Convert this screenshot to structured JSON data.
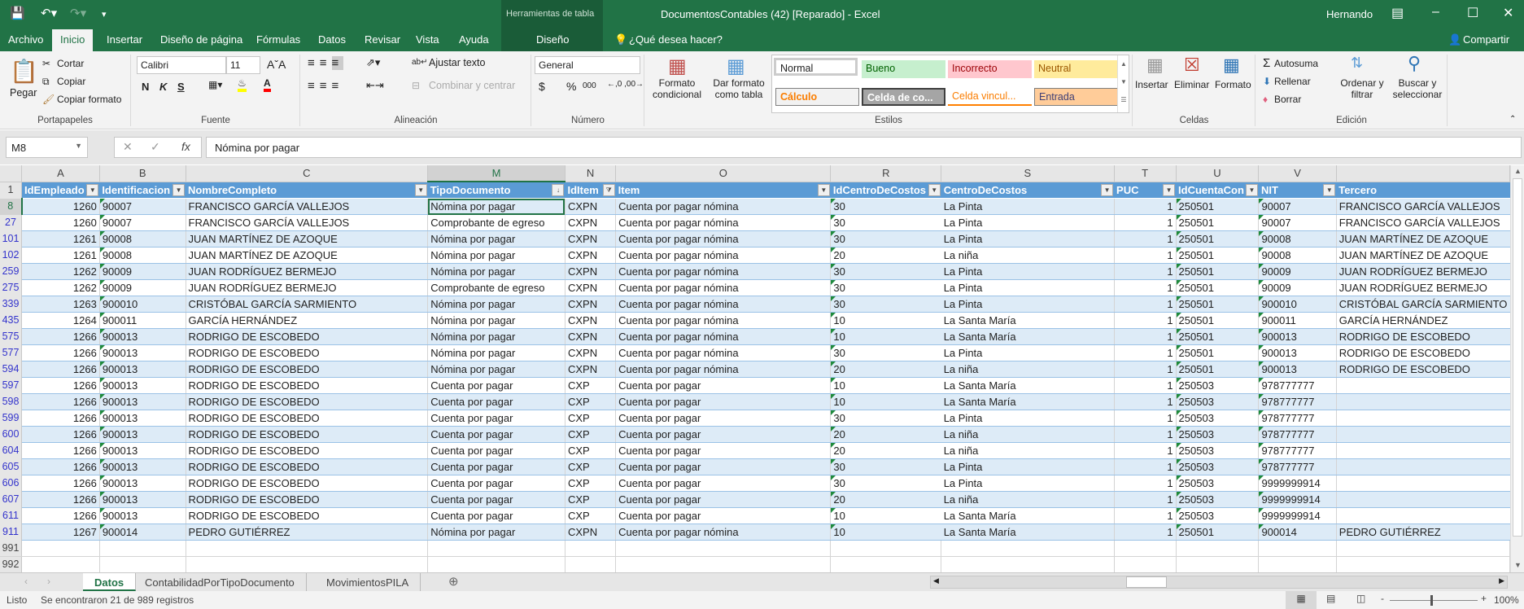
{
  "window": {
    "title": "DocumentosContables (42) [Reparado]  -  Excel",
    "contextual_group": "Herramientas de tabla",
    "user": "Hernando",
    "share": "Compartir"
  },
  "ribbon_tabs": [
    "Archivo",
    "Inicio",
    "Insertar",
    "Diseño de página",
    "Fórmulas",
    "Datos",
    "Revisar",
    "Vista",
    "Ayuda",
    "Diseño"
  ],
  "active_tab": "Inicio",
  "tell_me": "¿Qué desea hacer?",
  "ribbon": {
    "clipboard": {
      "label": "Portapapeles",
      "paste": "Pegar",
      "cut": "Cortar",
      "copy": "Copiar",
      "format_painter": "Copiar formato"
    },
    "font": {
      "label": "Fuente",
      "name": "Calibri",
      "size": "11",
      "bold": "N",
      "italic": "K",
      "underline": "S",
      "fill_color": "#ffff00",
      "font_color": "#ff0000"
    },
    "alignment": {
      "label": "Alineación",
      "wrap": "Ajustar texto",
      "merge": "Combinar y centrar"
    },
    "number": {
      "label": "Número",
      "format": "General",
      "currency": "$",
      "percent": "%",
      "thousands": "000"
    },
    "styles": {
      "label": "Estilos",
      "conditional": "Formato condicional",
      "as_table": "Dar formato como tabla",
      "cells": [
        {
          "label": "Normal",
          "bg": "#ffffff",
          "fg": "#000000"
        },
        {
          "label": "Bueno",
          "bg": "#c6efce",
          "fg": "#006100"
        },
        {
          "label": "Incorrecto",
          "bg": "#ffc7ce",
          "fg": "#9c0006"
        },
        {
          "label": "Neutral",
          "bg": "#ffeb9c",
          "fg": "#9c5700"
        },
        {
          "label": "Cálculo",
          "bg": "#f2f2f2",
          "fg": "#fa7d00"
        },
        {
          "label": "Celda de co...",
          "bg": "#a5a5a5",
          "fg": "#ffffff"
        },
        {
          "label": "Celda vincul...",
          "bg": "#ffffff",
          "fg": "#fa7d00"
        },
        {
          "label": "Entrada",
          "bg": "#ffcc99",
          "fg": "#3f3f76"
        }
      ]
    },
    "cells": {
      "label": "Celdas",
      "insert": "Insertar",
      "delete": "Eliminar",
      "format": "Formato"
    },
    "editing": {
      "label": "Edición",
      "autosum": "Autosuma",
      "fill": "Rellenar",
      "clear": "Borrar",
      "sort": "Ordenar y filtrar",
      "find": "Buscar y seleccionar"
    }
  },
  "formula_bar": {
    "name_box": "M8",
    "fx": "fx",
    "value": "Nómina por pagar"
  },
  "columns": [
    "A",
    "B",
    "C",
    "M",
    "N",
    "O",
    "R",
    "S",
    "T",
    "U",
    "V",
    ""
  ],
  "selected_column": "M",
  "headers": [
    "IdEmpleado",
    "Identificacion",
    "NombreCompleto",
    "TipoDocumento",
    "IdItem",
    "Item",
    "IdCentroDeCostos",
    "CentroDeCostos",
    "PUC",
    "IdCuentaCon",
    "NIT",
    "Tercero"
  ],
  "rows": [
    {
      "n": "8",
      "cells": [
        "1260",
        "90007",
        "FRANCISCO GARCÍA VALLEJOS",
        "Nómina por pagar",
        "CXPN",
        "Cuenta por pagar nómina",
        "30",
        "La Pinta",
        "1",
        "250501",
        "90007",
        "FRANCISCO GARCÍA VALLEJOS"
      ]
    },
    {
      "n": "27",
      "cells": [
        "1260",
        "90007",
        "FRANCISCO GARCÍA VALLEJOS",
        "Comprobante de egreso",
        "CXPN",
        "Cuenta por pagar nómina",
        "30",
        "La Pinta",
        "1",
        "250501",
        "90007",
        "FRANCISCO GARCÍA VALLEJOS"
      ]
    },
    {
      "n": "101",
      "cells": [
        "1261",
        "90008",
        "JUAN MARTÍNEZ DE AZOQUE",
        "Nómina por pagar",
        "CXPN",
        "Cuenta por pagar nómina",
        "30",
        "La Pinta",
        "1",
        "250501",
        "90008",
        "JUAN MARTÍNEZ DE AZOQUE"
      ]
    },
    {
      "n": "102",
      "cells": [
        "1261",
        "90008",
        "JUAN MARTÍNEZ DE AZOQUE",
        "Nómina por pagar",
        "CXPN",
        "Cuenta por pagar nómina",
        "20",
        "La niña",
        "1",
        "250501",
        "90008",
        "JUAN MARTÍNEZ DE AZOQUE"
      ]
    },
    {
      "n": "259",
      "cells": [
        "1262",
        "90009",
        "JUAN RODRÍGUEZ BERMEJO",
        "Nómina por pagar",
        "CXPN",
        "Cuenta por pagar nómina",
        "30",
        "La Pinta",
        "1",
        "250501",
        "90009",
        "JUAN RODRÍGUEZ BERMEJO"
      ]
    },
    {
      "n": "275",
      "cells": [
        "1262",
        "90009",
        "JUAN RODRÍGUEZ BERMEJO",
        "Comprobante de egreso",
        "CXPN",
        "Cuenta por pagar nómina",
        "30",
        "La Pinta",
        "1",
        "250501",
        "90009",
        "JUAN RODRÍGUEZ BERMEJO"
      ]
    },
    {
      "n": "339",
      "cells": [
        "1263",
        "900010",
        "CRISTÓBAL GARCÍA SARMIENTO",
        "Nómina por pagar",
        "CXPN",
        "Cuenta por pagar nómina",
        "30",
        "La Pinta",
        "1",
        "250501",
        "900010",
        "CRISTÓBAL GARCÍA SARMIENTO"
      ]
    },
    {
      "n": "435",
      "cells": [
        "1264",
        "900011",
        "GARCÍA HERNÁNDEZ",
        "Nómina por pagar",
        "CXPN",
        "Cuenta por pagar nómina",
        "10",
        "La Santa María",
        "1",
        "250501",
        "900011",
        "GARCÍA HERNÁNDEZ"
      ]
    },
    {
      "n": "575",
      "cells": [
        "1266",
        "900013",
        "RODRIGO DE ESCOBEDO",
        "Nómina por pagar",
        "CXPN",
        "Cuenta por pagar nómina",
        "10",
        "La Santa María",
        "1",
        "250501",
        "900013",
        "RODRIGO DE ESCOBEDO"
      ]
    },
    {
      "n": "577",
      "cells": [
        "1266",
        "900013",
        "RODRIGO DE ESCOBEDO",
        "Nómina por pagar",
        "CXPN",
        "Cuenta por pagar nómina",
        "30",
        "La Pinta",
        "1",
        "250501",
        "900013",
        "RODRIGO DE ESCOBEDO"
      ]
    },
    {
      "n": "594",
      "cells": [
        "1266",
        "900013",
        "RODRIGO DE ESCOBEDO",
        "Nómina por pagar",
        "CXPN",
        "Cuenta por pagar nómina",
        "20",
        "La niña",
        "1",
        "250501",
        "900013",
        "RODRIGO DE ESCOBEDO"
      ]
    },
    {
      "n": "597",
      "cells": [
        "1266",
        "900013",
        "RODRIGO DE ESCOBEDO",
        "Cuenta por pagar",
        "CXP",
        "Cuenta por pagar",
        "10",
        "La Santa María",
        "1",
        "250503",
        "978777777",
        ""
      ]
    },
    {
      "n": "598",
      "cells": [
        "1266",
        "900013",
        "RODRIGO DE ESCOBEDO",
        "Cuenta por pagar",
        "CXP",
        "Cuenta por pagar",
        "10",
        "La Santa María",
        "1",
        "250503",
        "978777777",
        ""
      ]
    },
    {
      "n": "599",
      "cells": [
        "1266",
        "900013",
        "RODRIGO DE ESCOBEDO",
        "Cuenta por pagar",
        "CXP",
        "Cuenta por pagar",
        "30",
        "La Pinta",
        "1",
        "250503",
        "978777777",
        ""
      ]
    },
    {
      "n": "600",
      "cells": [
        "1266",
        "900013",
        "RODRIGO DE ESCOBEDO",
        "Cuenta por pagar",
        "CXP",
        "Cuenta por pagar",
        "20",
        "La niña",
        "1",
        "250503",
        "978777777",
        ""
      ]
    },
    {
      "n": "604",
      "cells": [
        "1266",
        "900013",
        "RODRIGO DE ESCOBEDO",
        "Cuenta por pagar",
        "CXP",
        "Cuenta por pagar",
        "20",
        "La niña",
        "1",
        "250503",
        "978777777",
        ""
      ]
    },
    {
      "n": "605",
      "cells": [
        "1266",
        "900013",
        "RODRIGO DE ESCOBEDO",
        "Cuenta por pagar",
        "CXP",
        "Cuenta por pagar",
        "30",
        "La Pinta",
        "1",
        "250503",
        "978777777",
        ""
      ]
    },
    {
      "n": "606",
      "cells": [
        "1266",
        "900013",
        "RODRIGO DE ESCOBEDO",
        "Cuenta por pagar",
        "CXP",
        "Cuenta por pagar",
        "30",
        "La Pinta",
        "1",
        "250503",
        "9999999914",
        ""
      ]
    },
    {
      "n": "607",
      "cells": [
        "1266",
        "900013",
        "RODRIGO DE ESCOBEDO",
        "Cuenta por pagar",
        "CXP",
        "Cuenta por pagar",
        "20",
        "La niña",
        "1",
        "250503",
        "9999999914",
        ""
      ]
    },
    {
      "n": "611",
      "cells": [
        "1266",
        "900013",
        "RODRIGO DE ESCOBEDO",
        "Cuenta por pagar",
        "CXP",
        "Cuenta por pagar",
        "10",
        "La Santa María",
        "1",
        "250503",
        "9999999914",
        ""
      ]
    },
    {
      "n": "911",
      "cells": [
        "1267",
        "900014",
        "PEDRO GUTIÉRREZ",
        "Nómina por pagar",
        "CXPN",
        "Cuenta por pagar nómina",
        "10",
        "La Santa María",
        "1",
        "250501",
        "900014",
        "PEDRO GUTIÉRREZ"
      ]
    }
  ],
  "empty_rows": [
    "991",
    "992"
  ],
  "sheets": [
    "Datos",
    "ContabilidadPorTipoDocumento",
    "MovimientosPILA"
  ],
  "active_sheet": "Datos",
  "status": {
    "ready": "Listo",
    "filter_message": "Se encontraron 21 de 989 registros",
    "zoom": "100%"
  }
}
